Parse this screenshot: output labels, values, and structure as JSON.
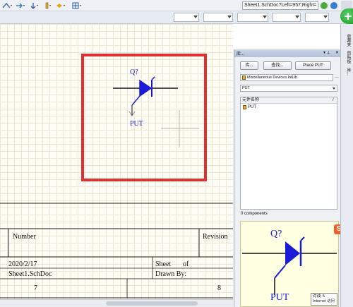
{
  "toolbar": {
    "sheet_field": "Sheet1.SchDoc?Left=957;Right="
  },
  "panel": {
    "title": "库...",
    "library_button": "库...",
    "search_button": "查找...",
    "place_button": "Place PUT",
    "library_select": "Miscellaneous Devices.IntLib",
    "filter_value": "PUT",
    "list_header": "元件名称",
    "list_header_sort": "/",
    "components": [
      {
        "name": "PUT"
      }
    ],
    "count_text": "0 components",
    "preview": {
      "designator": "Q?",
      "comment": "PUT"
    }
  },
  "schematic": {
    "part": {
      "designator": "Q?",
      "comment": "PUT"
    },
    "title_block": {
      "number_label": "Number",
      "revision_label": "Revision",
      "date": "2020/2/17",
      "sheet_label": "Sheet",
      "of_label": "of",
      "file": "Sheet1.SchDoc",
      "drawn_by_label": "Drawn By:",
      "zone_left": "7",
      "zone_right": "8"
    }
  },
  "right_dock": {
    "tabs": [
      "收藏夹",
      "剪贴板",
      "库..."
    ]
  },
  "status": {
    "tooltip_line1": "对战: 5",
    "tooltip_line2": "Internet 访问"
  },
  "colors": {
    "highlight": "#e03030",
    "symbol": "#1a1ad8",
    "panel_bg": "#eef0f3",
    "preview_bg": "#ffffe1"
  }
}
